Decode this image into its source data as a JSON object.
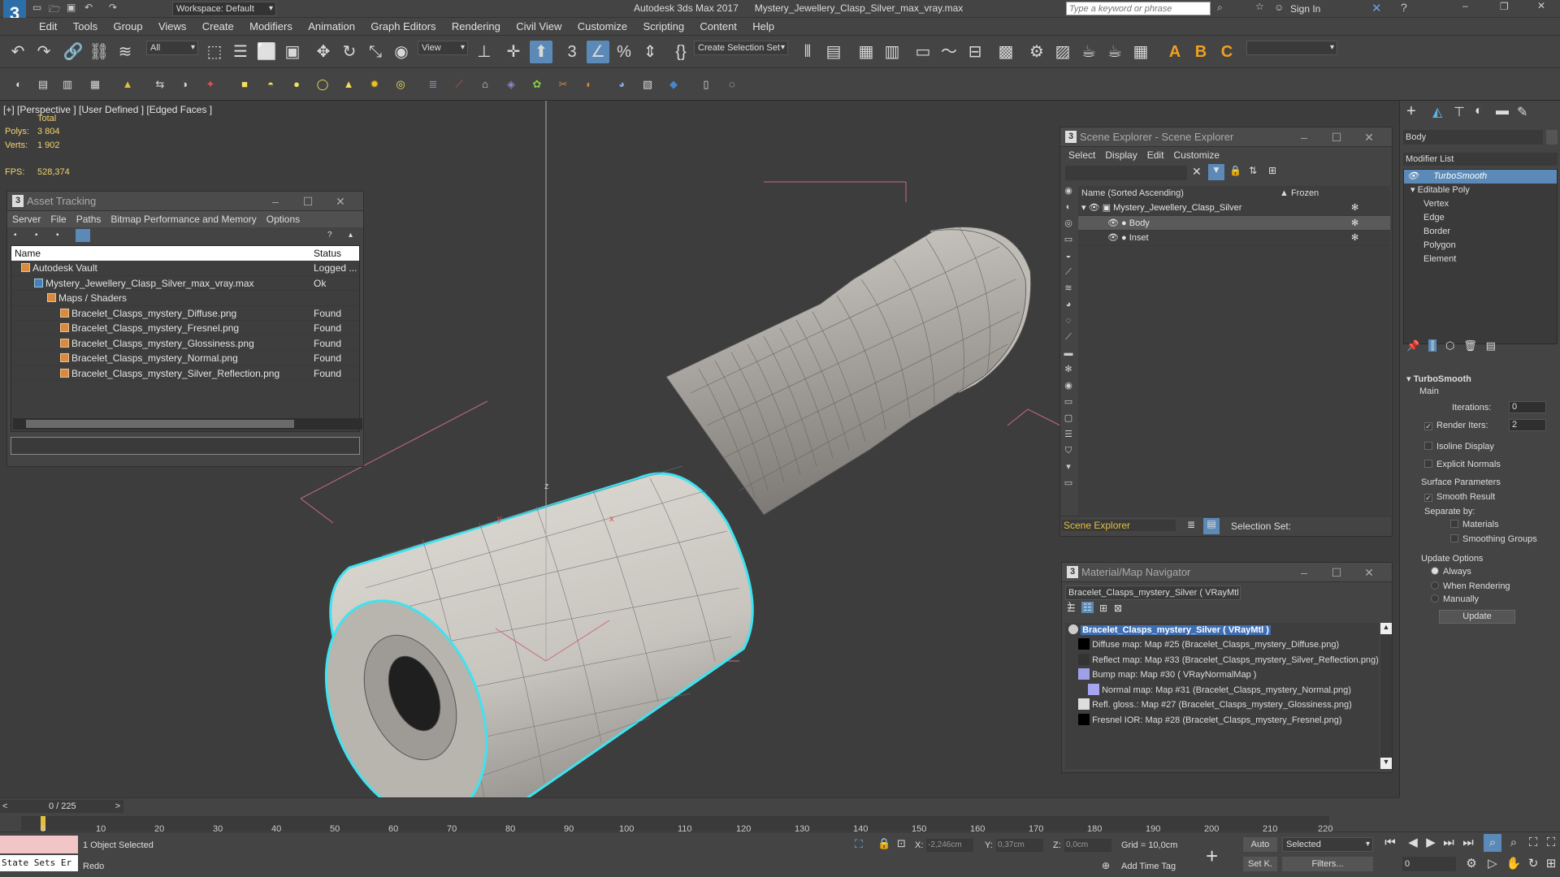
{
  "app": {
    "title": "Autodesk 3ds Max 2017",
    "file": "Mystery_Jewellery_Clasp_Silver_max_vray.max",
    "workspace": "Workspace: Default",
    "search_placeholder": "Type a keyword or phrase",
    "sign_in": "Sign In"
  },
  "menu": [
    "Edit",
    "Tools",
    "Group",
    "Views",
    "Create",
    "Modifiers",
    "Animation",
    "Graph Editors",
    "Rendering",
    "Civil View",
    "Customize",
    "Scripting",
    "Content",
    "Help"
  ],
  "toolbar": {
    "filter_dropdown": "All",
    "view_dropdown": "View",
    "selection_set": "Create Selection Set",
    "text_icons": [
      "A",
      "B",
      "C"
    ]
  },
  "viewport": {
    "label": "[+] [Perspective ]  [User Defined ]  [Edged Faces ]",
    "stats": {
      "total_label": "Total",
      "polys_label": "Polys:",
      "polys": "3 804",
      "verts_label": "Verts:",
      "verts": "1 902",
      "fps_label": "FPS:",
      "fps": "528,374"
    },
    "axes": {
      "x": "x",
      "y": "y",
      "z": "z"
    },
    "colors": {
      "selection": "#3fe3f0",
      "bbox": "#c96a82",
      "mesh": "#d4d0cb"
    }
  },
  "asset_tracking": {
    "title": "Asset Tracking",
    "menu": [
      "Server",
      "File",
      "Paths",
      "Bitmap Performance and Memory",
      "Options"
    ],
    "columns": [
      "Name",
      "Status"
    ],
    "rows": [
      {
        "name": "Autodesk Vault",
        "status": "Logged ..."
      },
      {
        "name": "Mystery_Jewellery_Clasp_Silver_max_vray.max",
        "status": "Ok"
      },
      {
        "name": "Maps / Shaders",
        "status": ""
      },
      {
        "name": "Bracelet_Clasps_mystery_Diffuse.png",
        "status": "Found"
      },
      {
        "name": "Bracelet_Clasps_mystery_Fresnel.png",
        "status": "Found"
      },
      {
        "name": "Bracelet_Clasps_mystery_Glossiness.png",
        "status": "Found"
      },
      {
        "name": "Bracelet_Clasps_mystery_Normal.png",
        "status": "Found"
      },
      {
        "name": "Bracelet_Clasps_mystery_Silver_Reflection.png",
        "status": "Found"
      }
    ]
  },
  "scene_explorer": {
    "title": "Scene Explorer - Scene Explorer",
    "menu": [
      "Select",
      "Display",
      "Edit",
      "Customize"
    ],
    "columns": {
      "name": "Name (Sorted Ascending)",
      "frozen": "▲ Frozen"
    },
    "root": "Mystery_Jewellery_Clasp_Silver",
    "children": [
      "Body",
      "Inset"
    ],
    "footer_label": "Scene Explorer",
    "selection_set_label": "Selection Set:"
  },
  "material_navigator": {
    "title": "Material/Map Navigator",
    "current": "Bracelet_Clasps_mystery_Silver  ( VRayMtl )",
    "root": "Bracelet_Clasps_mystery_Silver  ( VRayMtl )",
    "items": [
      "Diffuse map: Map #25 (Bracelet_Clasps_mystery_Diffuse.png)",
      "Reflect map: Map #33 (Bracelet_Clasps_mystery_Silver_Reflection.png)",
      "Bump map: Map #30  ( VRayNormalMap )",
      "Normal map: Map #31 (Bracelet_Clasps_mystery_Normal.png)",
      "Refl. gloss.: Map #27 (Bracelet_Clasps_mystery_Glossiness.png)",
      "Fresnel IOR: Map #28 (Bracelet_Clasps_mystery_Fresnel.png)"
    ]
  },
  "command_panel": {
    "object_name": "Body",
    "modifier_list": "Modifier List",
    "stack": [
      "TurboSmooth",
      "Editable Poly",
      "Vertex",
      "Edge",
      "Border",
      "Polygon",
      "Element"
    ],
    "rollout": "TurboSmooth",
    "main": "Main",
    "iterations_label": "Iterations:",
    "iterations": "0",
    "render_iters_label": "Render Iters:",
    "render_iters": "2",
    "isoline": "Isoline Display",
    "explicit_normals": "Explicit Normals",
    "surface_params": "Surface Parameters",
    "smooth_result": "Smooth Result",
    "separate_by": "Separate by:",
    "materials": "Materials",
    "smoothing_groups": "Smoothing Groups",
    "update_options": "Update Options",
    "always": "Always",
    "when_rendering": "When Rendering",
    "manually": "Manually",
    "update_btn": "Update"
  },
  "timeline": {
    "frame": "0 / 225",
    "ticks": [
      "10",
      "20",
      "30",
      "40",
      "50",
      "60",
      "70",
      "80",
      "90",
      "100",
      "110",
      "120",
      "130",
      "140",
      "150",
      "160",
      "170",
      "180",
      "190",
      "200",
      "210",
      "220"
    ],
    "ticks_start": "0"
  },
  "statusbar": {
    "state_sets": "State Sets Er",
    "selected": "1 Object Selected",
    "prompt": "Redo",
    "x_label": "X:",
    "x": "-2,246cm",
    "y_label": "Y:",
    "y": "0,37cm",
    "z_label": "Z:",
    "z": "0,0cm",
    "grid": "Grid = 10,0cm",
    "add_time_tag": "Add Time Tag",
    "auto": "Auto",
    "setk": "Set K.",
    "selected_dd": "Selected",
    "filters": "Filters...",
    "frame_field": "0"
  }
}
